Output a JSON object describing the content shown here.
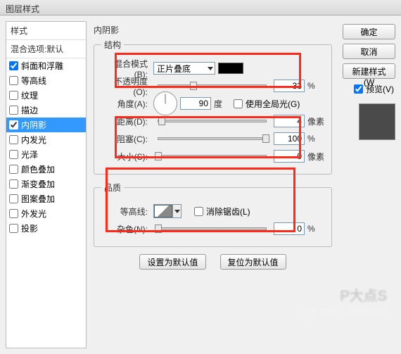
{
  "window": {
    "title": "图层样式"
  },
  "left": {
    "header": "样式",
    "sub": "混合选项:默认",
    "items": [
      {
        "label": "斜面和浮雕",
        "checked": true,
        "selected": false
      },
      {
        "label": "等高线",
        "checked": false,
        "selected": false
      },
      {
        "label": "纹理",
        "checked": false,
        "selected": false
      },
      {
        "label": "描边",
        "checked": false,
        "selected": false
      },
      {
        "label": "内阴影",
        "checked": true,
        "selected": true
      },
      {
        "label": "内发光",
        "checked": false,
        "selected": false
      },
      {
        "label": "光泽",
        "checked": false,
        "selected": false
      },
      {
        "label": "颜色叠加",
        "checked": false,
        "selected": false
      },
      {
        "label": "渐变叠加",
        "checked": false,
        "selected": false
      },
      {
        "label": "图案叠加",
        "checked": false,
        "selected": false
      },
      {
        "label": "外发光",
        "checked": false,
        "selected": false
      },
      {
        "label": "投影",
        "checked": false,
        "selected": false
      }
    ]
  },
  "center": {
    "panel_title": "内阴影",
    "structure": {
      "legend": "结构",
      "blend_label": "混合模式(B):",
      "blend_value": "正片叠底",
      "opacity_label": "不透明度(O):",
      "opacity_value": "33",
      "opacity_unit": "%",
      "angle_label": "角度(A):",
      "angle_value": "90",
      "angle_unit": "度",
      "global_label": "使用全局光(G)",
      "distance_label": "距离(D):",
      "distance_value": "4",
      "distance_unit": "像素",
      "choke_label": "阻塞(C):",
      "choke_value": "100",
      "choke_unit": "%",
      "size_label": "大小(S):",
      "size_value": "0",
      "size_unit": "像素"
    },
    "quality": {
      "legend": "品质",
      "contour_label": "等高线:",
      "anti_label": "消除锯齿(L)",
      "noise_label": "杂色(N):",
      "noise_value": "0",
      "noise_unit": "%"
    },
    "buttons": {
      "default": "设置为默认值",
      "reset": "复位为默认值"
    }
  },
  "right": {
    "ok": "确定",
    "cancel": "取消",
    "newstyle": "新建样式(W",
    "preview_label": "预览(V)"
  },
  "watermark": {
    "line1": "P大点S",
    "line2": "qq交流群：303184032"
  }
}
